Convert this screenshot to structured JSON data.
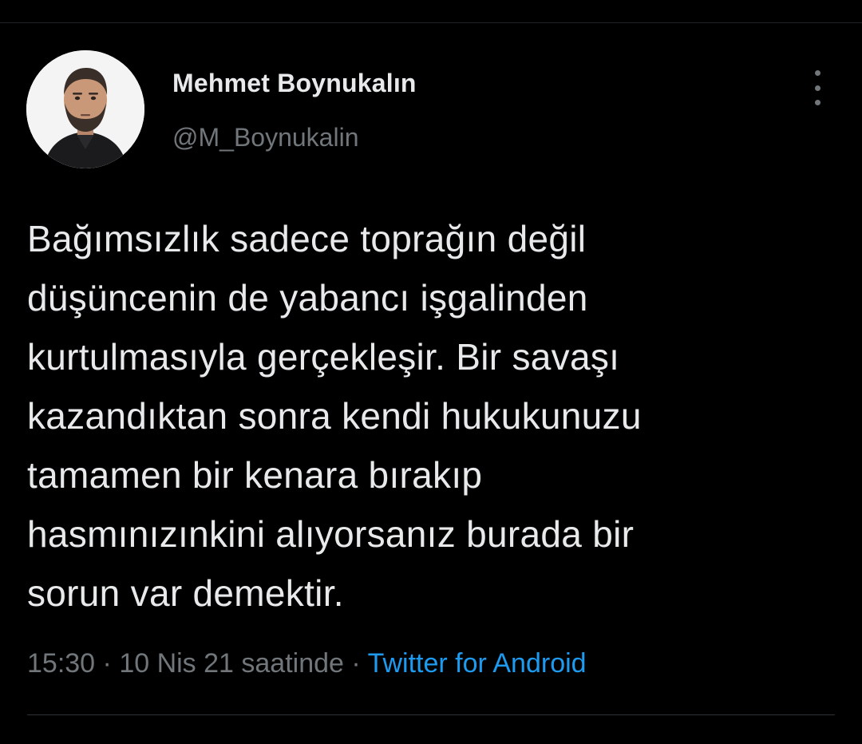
{
  "author": {
    "name": "Mehmet Boynukalın",
    "handle": "@M_Boynukalin"
  },
  "menu": {
    "icon": "more-vertical-icon"
  },
  "tweet": {
    "lines": [
      "Bağımsızlık sadece toprağın değil",
      "düşüncenin de yabancı işgalinden",
      "kurtulmasıyla gerçekleşir. Bir savaşı",
      "kazandıktan sonra kendi hukukunuzu",
      "tamamen bir kenara bırakıp",
      "hasmınızınkini alıyorsanız burada bir",
      "sorun var demektir."
    ]
  },
  "meta": {
    "time": "15:30",
    "separator": " · ",
    "date": "10 Nis 21 saatinde",
    "source": "Twitter for Android"
  },
  "colors": {
    "background": "#000000",
    "text": "#e7e9ea",
    "secondary": "#71767b",
    "link": "#1d9bf0"
  }
}
